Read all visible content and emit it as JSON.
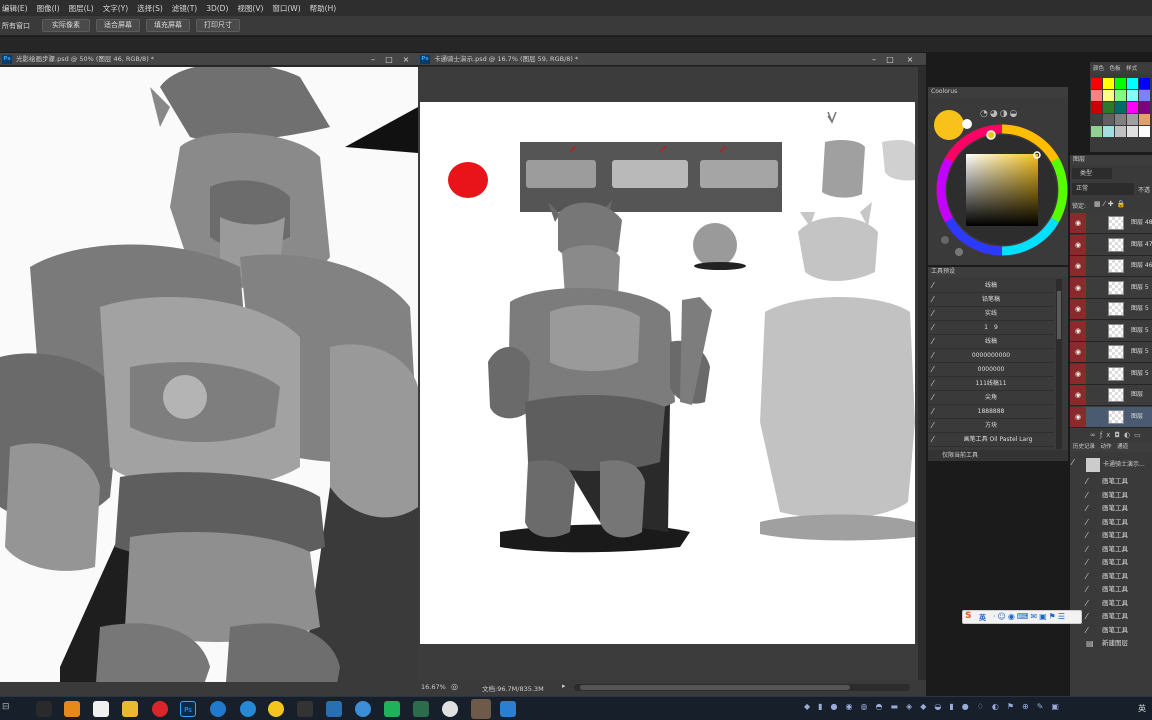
{
  "menubar": [
    "编辑(E)",
    "图像(I)",
    "图层(L)",
    "文字(Y)",
    "选择(S)",
    "滤镜(T)",
    "3D(D)",
    "视图(V)",
    "窗口(W)",
    "帮助(H)"
  ],
  "options": {
    "label": "所有窗口",
    "buttons": [
      "实际像素",
      "适合屏幕",
      "填充屏幕",
      "打印尺寸"
    ]
  },
  "doc1": {
    "title": "光影绘画步骤.psd @ 50% (图层 46, RGB/8) *"
  },
  "doc2": {
    "title": "卡通骑士演示.psd @ 16.7% (图层 59, RGB/8) *",
    "zoom": "16.67%",
    "docsize": "文档:96.7M/835.3M"
  },
  "coolorus": {
    "title": "Coolorus",
    "current_color": "#f8c21a"
  },
  "swatches": {
    "tabs": [
      "颜色",
      "色板",
      "样式"
    ]
  },
  "presets": {
    "title": "工具预设",
    "items": [
      "线稿",
      "铅笔稿",
      "实线",
      "1　9",
      "线稿",
      "0000000000",
      "0000000",
      "111线稿11",
      "尖角",
      "1888888",
      "方块",
      "画笔工具 Oil Pastel Larg"
    ],
    "footer": "仅限当前工具"
  },
  "layers": {
    "title": "图层",
    "kind": "类型",
    "blend": "正常",
    "opacity_label": "不透",
    "lock_label": "锁定:",
    "rows": [
      "图层 48",
      "图层 47",
      "图层 46",
      "图层 5",
      "图层 5",
      "图层 5",
      "图层 5",
      "图层 5",
      "图层",
      "图层"
    ]
  },
  "history": {
    "tabs": [
      "历史记录",
      "动作",
      "通道"
    ],
    "snapshot": "卡通骑士演示...",
    "rows": [
      "画笔工具",
      "画笔工具",
      "画笔工具",
      "画笔工具",
      "画笔工具",
      "画笔工具",
      "画笔工具",
      "画笔工具",
      "画笔工具",
      "画笔工具",
      "画笔工具",
      "画笔工具",
      "新建图层"
    ]
  },
  "tray": {
    "time_glyph": "英"
  }
}
